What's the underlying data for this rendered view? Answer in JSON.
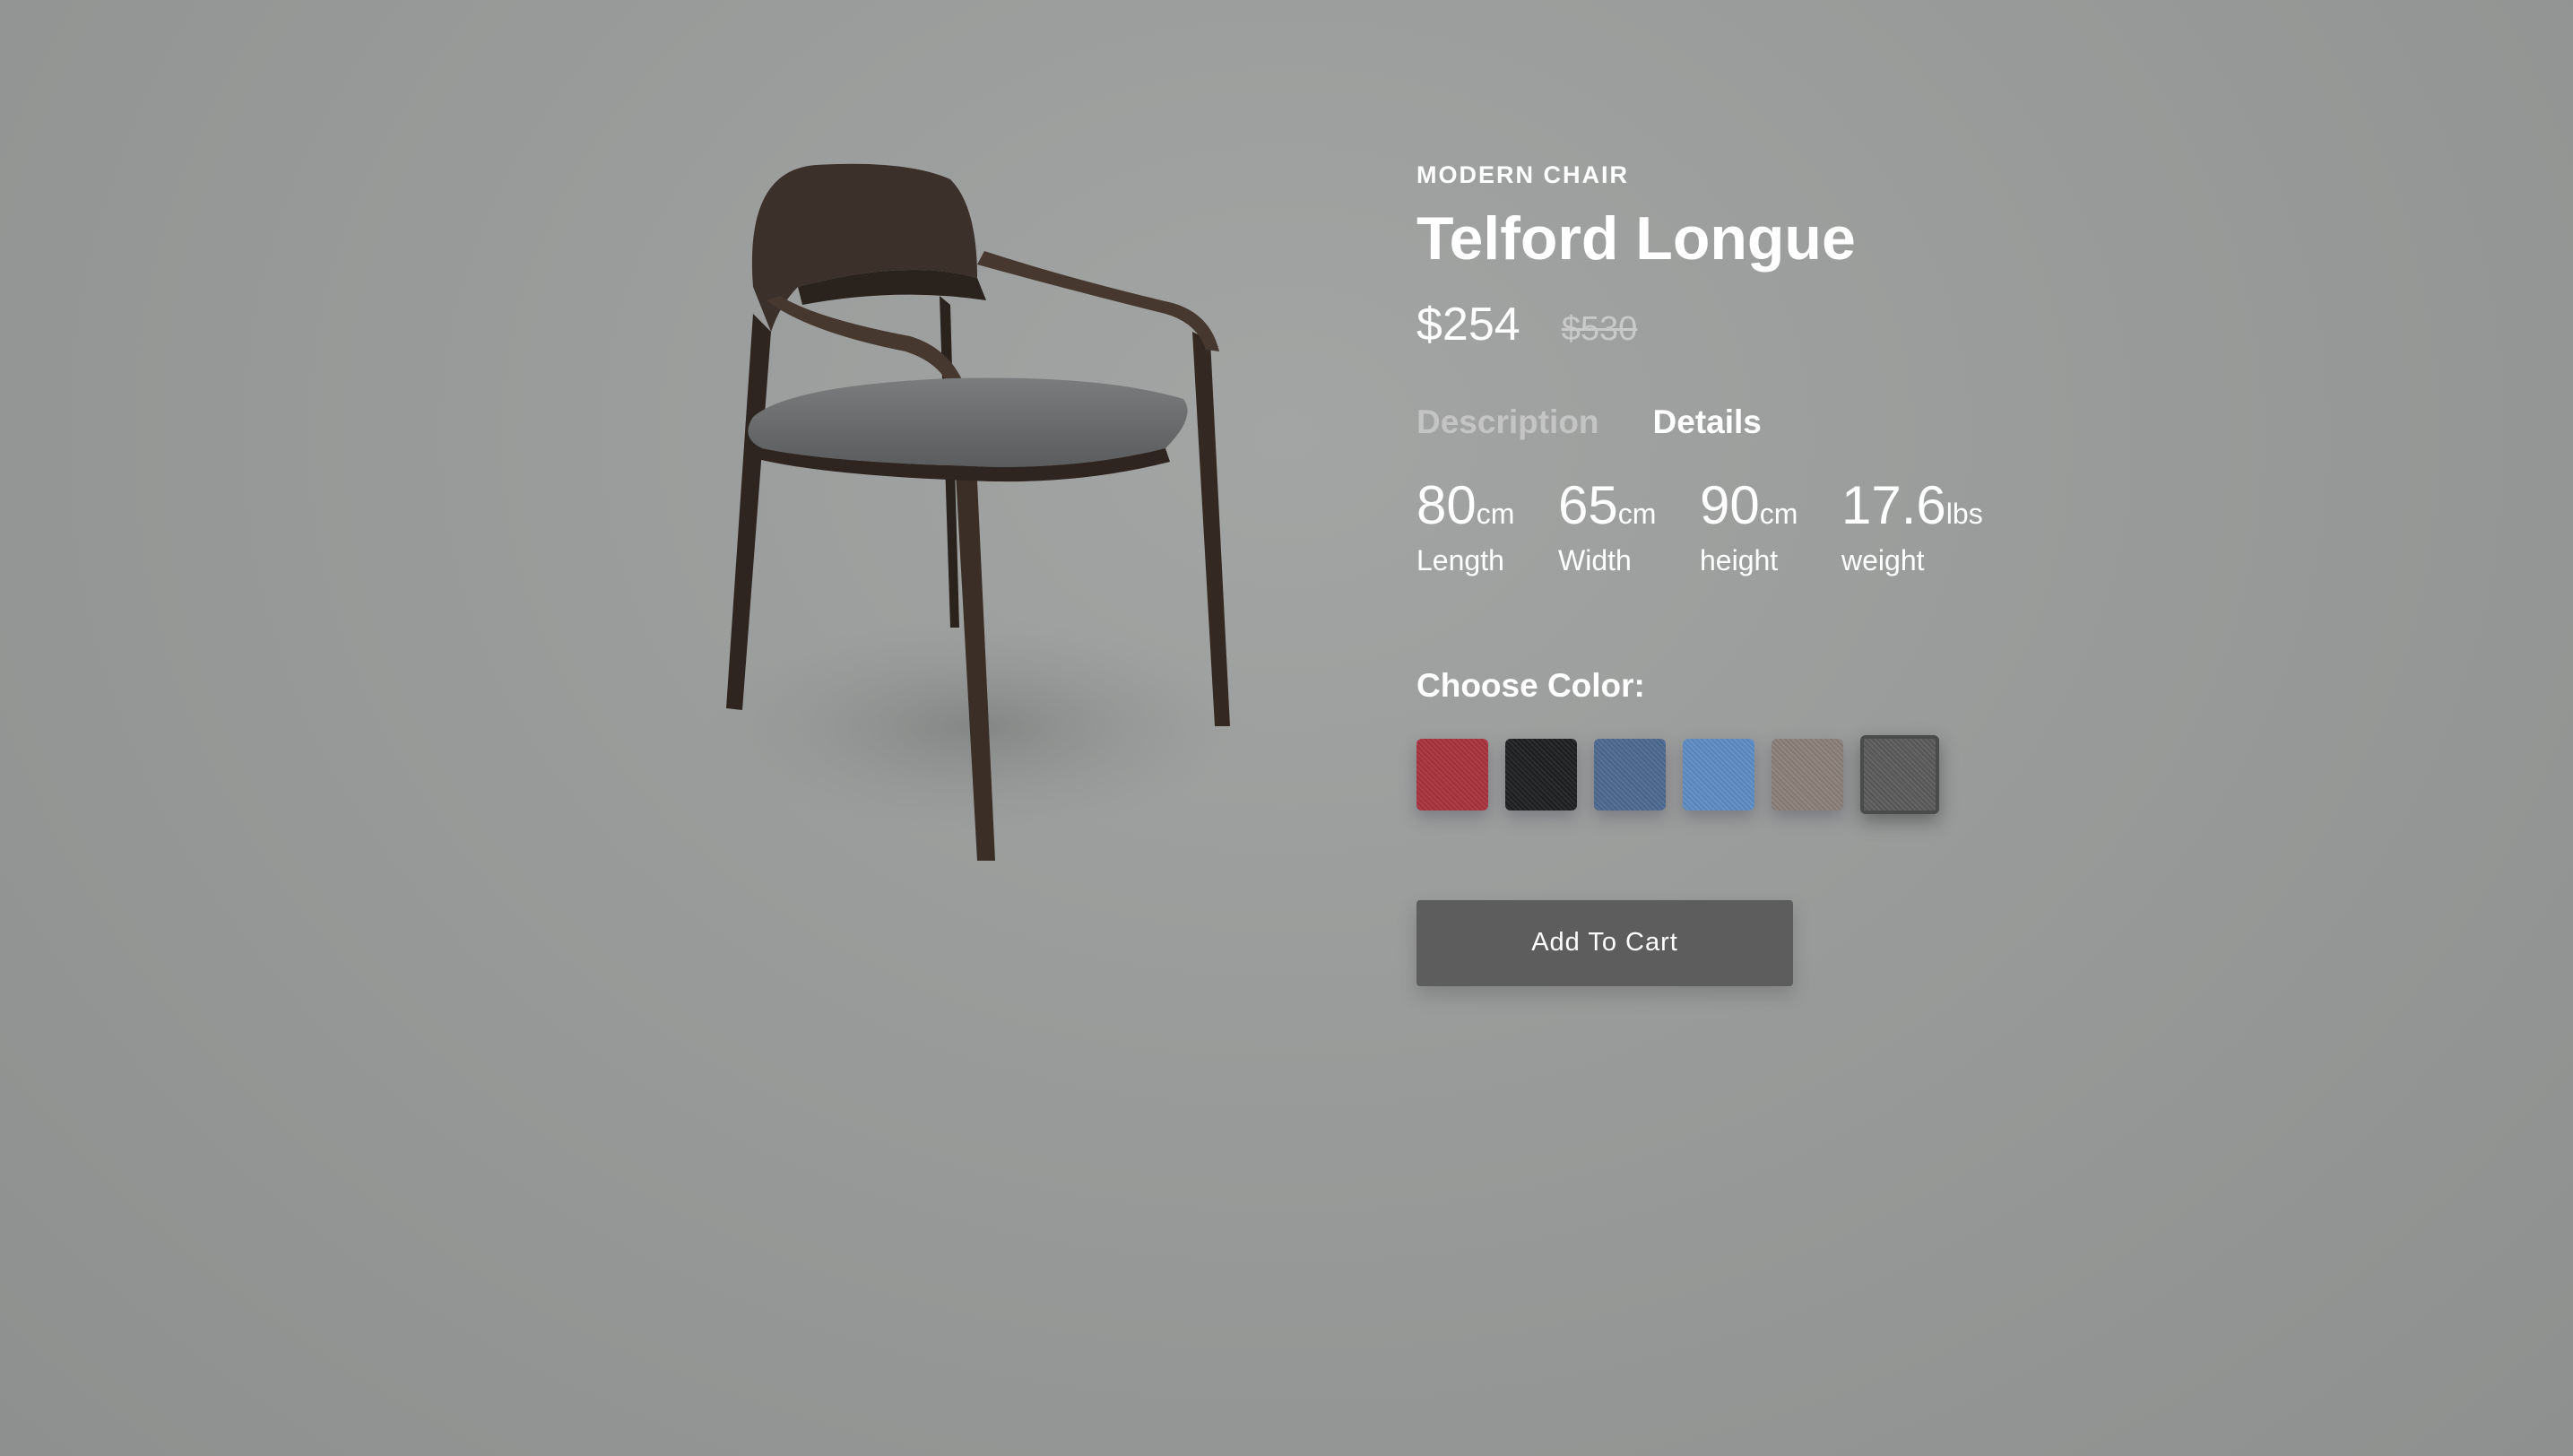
{
  "product": {
    "category": "MODERN CHAIR",
    "name": "Telford Longue",
    "price": "$254",
    "old_price": "$530",
    "image": "chair-image"
  },
  "tabs": [
    "Description",
    "Details"
  ],
  "specs": [
    {
      "value": "80",
      "unit": "cm",
      "label": "Length"
    },
    {
      "value": "65",
      "unit": "cm",
      "label": "Width"
    },
    {
      "value": "90",
      "unit": "cm",
      "label": "height"
    },
    {
      "value": "17.6",
      "unit": "lbs",
      "label": "weight"
    }
  ],
  "color_picker": {
    "label": "Choose Color:",
    "colors": [
      "#a8323c",
      "#1f2022",
      "#4d6890",
      "#5d8cc4",
      "#8a7f78",
      "#5a5b5a"
    ],
    "selected_index": 5
  },
  "cart_button": "Add To Cart"
}
